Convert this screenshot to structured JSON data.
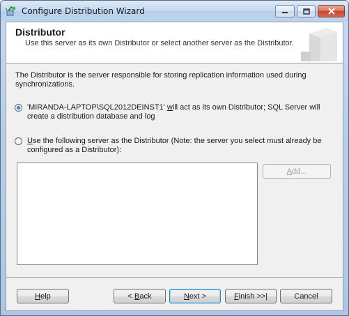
{
  "window": {
    "title": "Configure Distribution Wizard",
    "icon": "wizard-icon",
    "buttons": {
      "minimize": "minimize-icon",
      "maximize": "maximize-icon",
      "close": "close-icon"
    }
  },
  "header": {
    "title": "Distributor",
    "subtitle": "Use this server as its own Distributor or select another server as the Distributor."
  },
  "body": {
    "description": "The Distributor is the server responsible for storing replication information used during synchronizations.",
    "option1": {
      "prefix": "'MIRANDA-LAPTOP\\SQL2012DEINST1' ",
      "mnemonic": "w",
      "suffix": "ill act as its own Distributor; SQL Server will create a distribution database and log",
      "checked": true
    },
    "option2": {
      "mnemonic": "U",
      "suffix": "se the following server as the Distributor (Note: the server you select must already be configured as a Distributor):",
      "checked": false
    },
    "server_list": [],
    "add_button": {
      "mnemonic": "A",
      "rest": "dd...",
      "enabled": false
    }
  },
  "footer": {
    "help": {
      "mnemonic": "H",
      "rest": "elp"
    },
    "back": {
      "pre": "< ",
      "mnemonic": "B",
      "rest": "ack"
    },
    "next": {
      "mnemonic": "N",
      "rest": "ext >"
    },
    "finish": {
      "mnemonic": "F",
      "rest": "inish >>|"
    },
    "cancel": {
      "label": "Cancel"
    }
  },
  "colors": {
    "title_bar": "#c6d9f1",
    "close_button": "#c5452f",
    "dialog_bg": "#f0f0f0"
  }
}
